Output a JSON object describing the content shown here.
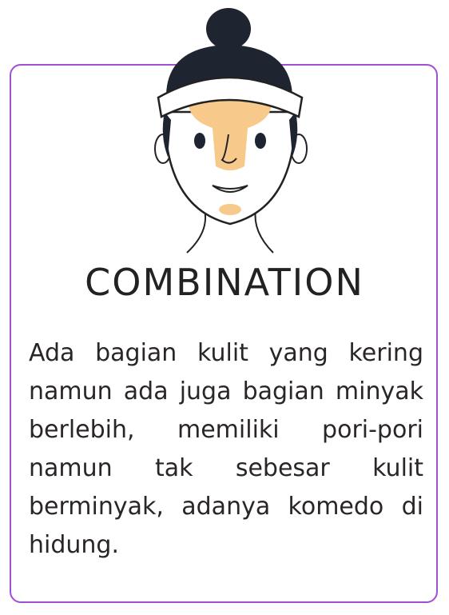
{
  "card": {
    "title": "COMBINATION",
    "description": "Ada bagian kulit yang kering namun ada juga bagian minyak berlebih, memiliki pori-pori namun tak sebesar kulit berminyak, adanya komedo di hidung."
  },
  "colors": {
    "border": "#a24fd0",
    "oily_zone": "#f7c98a",
    "hair": "#1e2530",
    "text": "#2a2626"
  },
  "icons": {
    "illustration": "face-illustration"
  }
}
